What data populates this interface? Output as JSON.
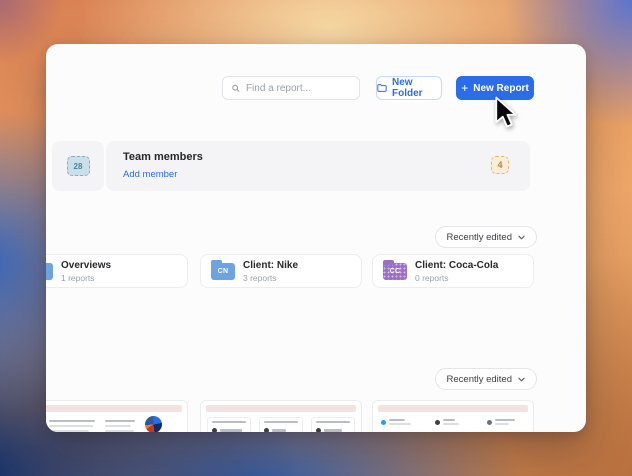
{
  "window": {
    "toolbar": {
      "search_placeholder": "Find a report...",
      "new_folder_label": "New Folder",
      "new_report_label": "New Report",
      "plus_glyph": "+"
    },
    "team": {
      "avatar_text": "28",
      "title": "Team members",
      "add_member_label": "Add member",
      "count_badge": "4"
    },
    "folders_section": {
      "sort_label": "Recently edited",
      "items": [
        {
          "title": "Overviews",
          "subtitle": "1 reports",
          "initials": "",
          "folder_color": "#6ba3e3"
        },
        {
          "title": "Client: Nike",
          "subtitle": "3 reports",
          "initials": "CN",
          "folder_color": "#6ba3e3"
        },
        {
          "title": "Client: Coca-Cola",
          "subtitle": "0 reports",
          "initials": "CC",
          "folder_color": "#9b6fc6"
        }
      ]
    },
    "reports_section": {
      "sort_label": "Recently edited",
      "thumbnail_count": 3
    }
  },
  "colors": {
    "accent_blue": "#2b6ce8",
    "banner_gray": "#f4f4f6",
    "count_badge_bg": "#fbeed8",
    "count_badge_text": "#c07f33",
    "avatar_badge_bg": "#cadfe9",
    "avatar_badge_text": "#49839e",
    "thumb_header_strip": "#f3e2df"
  }
}
